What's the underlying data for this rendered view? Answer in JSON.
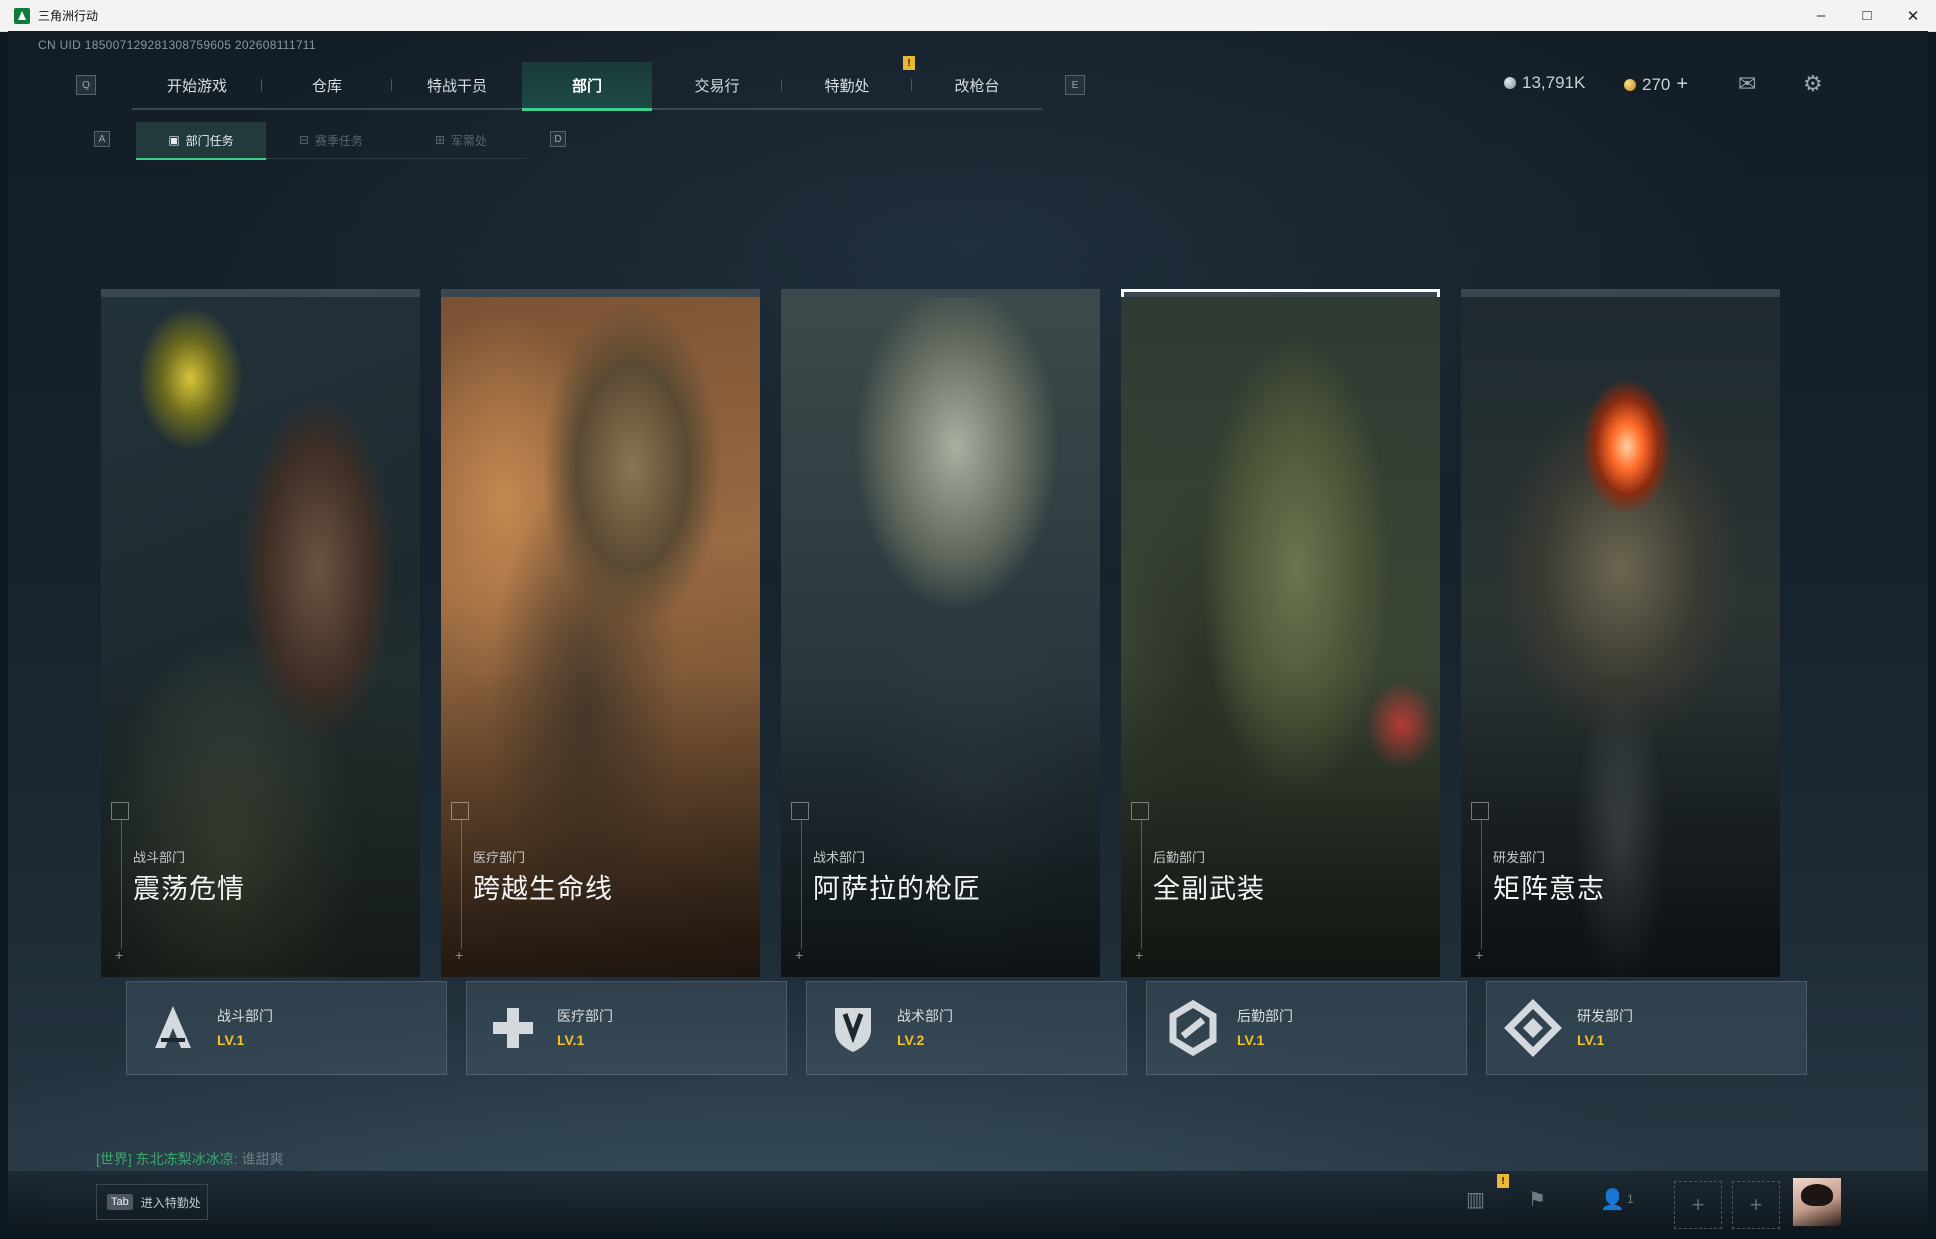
{
  "window": {
    "title": "三角洲行动",
    "minimize": "–",
    "maximize": "□",
    "close": "✕"
  },
  "uid": "CN UID 185007129281308759605 202608111711",
  "main_tabs": [
    {
      "label": "开始游戏",
      "active": false
    },
    {
      "label": "仓库",
      "active": false
    },
    {
      "label": "特战干员",
      "active": false
    },
    {
      "label": "部门",
      "active": true
    },
    {
      "label": "交易行",
      "active": false
    },
    {
      "label": "特勤处",
      "active": false,
      "alert": true
    },
    {
      "label": "改枪台",
      "active": false
    }
  ],
  "main_tab_keys": {
    "left": "Q",
    "right": "E"
  },
  "sub_tabs": [
    {
      "label": "部门任务",
      "icon": "task-icon",
      "active": true
    },
    {
      "label": "赛季任务",
      "icon": "season-icon",
      "active": false
    },
    {
      "label": "军需处",
      "icon": "supply-icon",
      "active": false
    }
  ],
  "sub_tab_keys": {
    "left": "A",
    "right": "D"
  },
  "alert_mark": "!",
  "currency": {
    "silver": "13,791K",
    "gold": "270",
    "gold_add": "+"
  },
  "departments": [
    {
      "category": "战斗部门",
      "name": "震荡危情",
      "dept": "战斗部门",
      "level": "LV.1",
      "icon": "combat-department-icon",
      "selected": false
    },
    {
      "category": "医疗部门",
      "name": "跨越生命线",
      "dept": "医疗部门",
      "level": "LV.1",
      "icon": "medical-department-icon",
      "selected": false
    },
    {
      "category": "战术部门",
      "name": "阿萨拉的枪匠",
      "dept": "战术部门",
      "level": "LV.2",
      "icon": "tactical-department-icon",
      "selected": false
    },
    {
      "category": "后勤部门",
      "name": "全副武装",
      "dept": "后勤部门",
      "level": "LV.1",
      "icon": "logistics-department-icon",
      "selected": true
    },
    {
      "category": "研发部门",
      "name": "矩阵意志",
      "dept": "研发部门",
      "level": "LV.1",
      "icon": "research-department-icon",
      "selected": false
    }
  ],
  "chat": {
    "channel": "[世界] 东北冻梨冰冰凉:",
    "message": "谁甜爽"
  },
  "bottom": {
    "tab_key": "Tab",
    "tab_label": "进入特勤处",
    "friend_count": "1",
    "slot_add": "+"
  }
}
